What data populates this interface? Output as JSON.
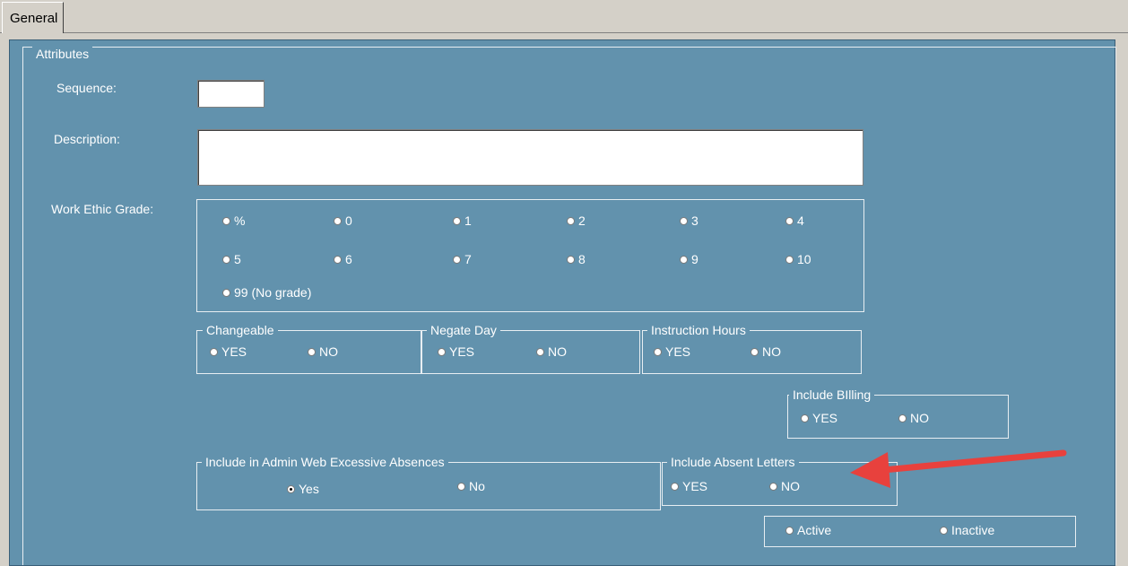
{
  "tabs": {
    "general": "General"
  },
  "attributes": {
    "legend": "Attributes",
    "sequence": {
      "label": "Sequence:",
      "value": ""
    },
    "description": {
      "label": "Description:",
      "value": ""
    },
    "work_ethic": {
      "label": "Work Ethic Grade:",
      "options": [
        "%",
        "0",
        "1",
        "2",
        "3",
        "4",
        "5",
        "6",
        "7",
        "8",
        "9",
        "10",
        "99 (No grade)"
      ]
    },
    "changeable": {
      "legend": "Changeable",
      "yes": "YES",
      "no": "NO"
    },
    "negate_day": {
      "legend": "Negate Day",
      "yes": "YES",
      "no": "NO"
    },
    "instruction_hours": {
      "legend": "Instruction Hours",
      "yes": "YES",
      "no": "NO"
    },
    "include_billing": {
      "legend": "Include BIlling",
      "yes": "YES",
      "no": "NO"
    },
    "excessive_absences": {
      "legend": "Include in Admin Web Excessive Absences",
      "yes": "Yes",
      "no": "No",
      "selected": "Yes"
    },
    "absent_letters": {
      "legend": "Include Absent Letters",
      "yes": "YES",
      "no": "NO"
    },
    "status": {
      "active": "Active",
      "inactive": "Inactive"
    }
  },
  "annotation": {
    "arrow_color": "#e8413d"
  }
}
